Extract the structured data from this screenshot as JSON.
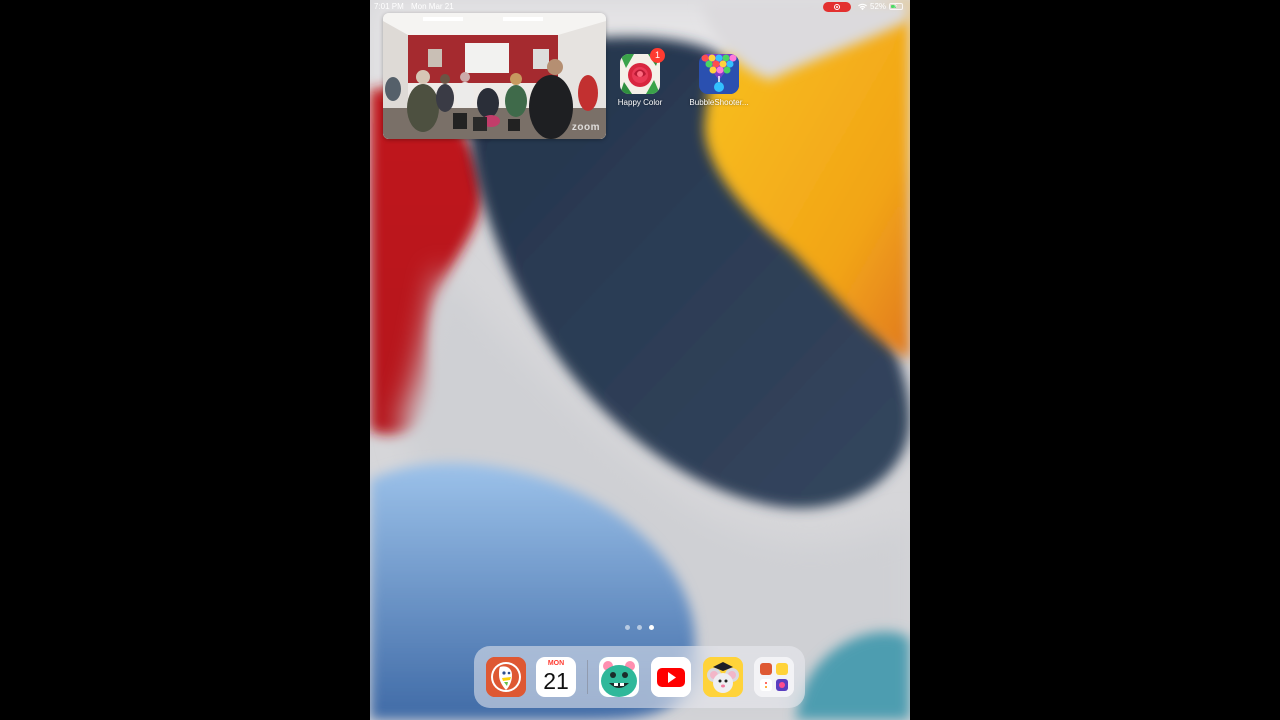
{
  "status_bar": {
    "time": "7:01 PM",
    "date": "Mon Mar 21",
    "battery_percent": "52%",
    "battery_level": 0.52,
    "screen_recording": true,
    "recording_color": "#e3302f"
  },
  "widget": {
    "name": "zoom-meeting-widget",
    "watermark": "zoom"
  },
  "home_apps": [
    {
      "label": "Happy Color",
      "badge": "1",
      "icon": "happy-color-icon"
    },
    {
      "label": "BubbleShooter...",
      "icon": "bubble-shooter-icon"
    }
  ],
  "page_indicator": {
    "pages": 3,
    "current": 3
  },
  "dock": {
    "apps": [
      {
        "name": "duckduckgo",
        "icon": "duckduckgo-icon"
      },
      {
        "name": "calendar",
        "icon": "calendar-icon",
        "day": "MON",
        "date": "21"
      },
      {
        "name": "kids-app",
        "icon": "green-bear-icon"
      },
      {
        "name": "youtube",
        "icon": "youtube-icon"
      },
      {
        "name": "abcmouse",
        "icon": "mouse-graduate-icon"
      },
      {
        "name": "app-library",
        "icon": "app-library-icon"
      }
    ]
  },
  "colors": {
    "wallpaper_red": "#c8121b",
    "wallpaper_navy": "#2c3b52",
    "wallpaper_yellow": "#f6b21b",
    "wallpaper_blue": "#7fa8d6",
    "badge_red": "#ff3b30"
  }
}
